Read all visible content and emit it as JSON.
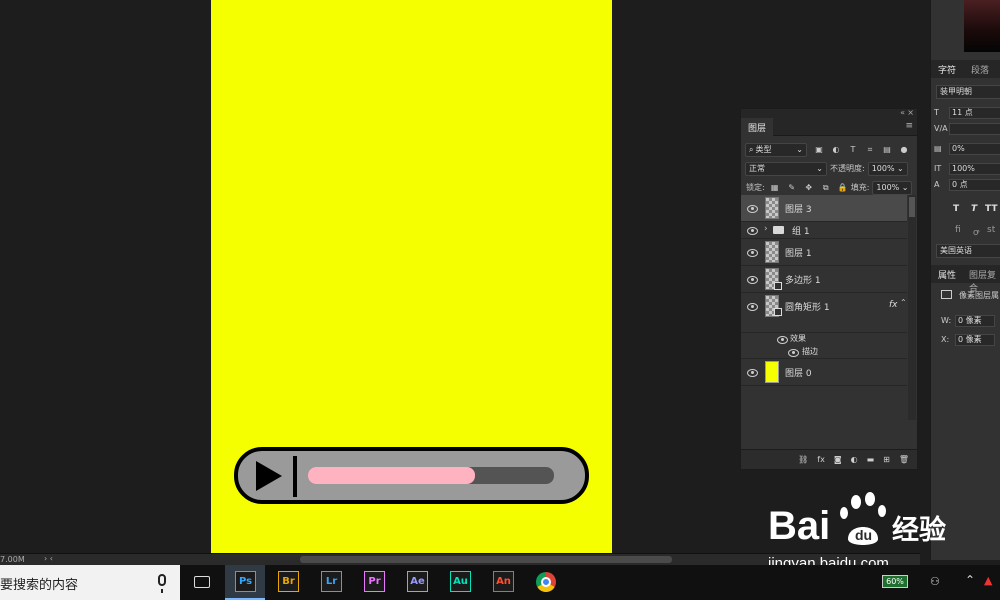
{
  "app": {
    "name": "Photoshop"
  },
  "status_bar": {
    "doc_size": "7.00M",
    "arrows": "› ‹"
  },
  "player": {
    "progress": 0.68,
    "progress_color": "#ffb3c1",
    "canvas_color": "#f5ff00"
  },
  "layers_panel": {
    "tab": "图层",
    "filter": {
      "label": "类型"
    },
    "blend_mode": "正常",
    "opacity_label": "不透明度:",
    "opacity": "100%",
    "lock_label": "锁定:",
    "fill_label": "填充:",
    "fill": "100%",
    "layers": [
      {
        "name": "图层 3",
        "kind": "checker",
        "selected": true,
        "visible": true
      },
      {
        "name": "组 1",
        "kind": "group",
        "selected": false,
        "visible": true
      },
      {
        "name": "图层 1",
        "kind": "checker",
        "selected": false,
        "visible": true
      },
      {
        "name": "多边形 1",
        "kind": "shape",
        "selected": false,
        "visible": true
      },
      {
        "name": "圆角矩形 1",
        "kind": "shape",
        "selected": false,
        "visible": true,
        "fx": "fx",
        "effects_label": "效果",
        "effects": [
          "描边"
        ]
      },
      {
        "name": "图层 0",
        "kind": "yellow",
        "selected": false,
        "visible": true
      }
    ]
  },
  "character_panel": {
    "tabs": [
      "字符",
      "段落"
    ],
    "font_family": "装甲明朝",
    "font_size": "11 点",
    "va_value": "",
    "scale_pct": "0%",
    "vertical_scale": "100%",
    "baseline": "0 点",
    "language": "美国英语"
  },
  "properties_panel": {
    "tabs": [
      "属性",
      "图层复合"
    ],
    "pixel_layer_label": "像素图层属",
    "w_label": "W:",
    "w_value": "0 像素",
    "x_label": "X:",
    "x_value": "0 像素"
  },
  "taskbar": {
    "search_placeholder": "要搜索的内容",
    "apps": [
      {
        "label": "Ps",
        "color": "#31a8ff",
        "active": true
      },
      {
        "label": "Br",
        "color": "#e8a600"
      },
      {
        "label": "Lr",
        "color": "#31a8ff"
      },
      {
        "label": "Pr",
        "color": "#ea77ff"
      },
      {
        "label": "Ae",
        "color": "#9999ff"
      },
      {
        "label": "Au",
        "color": "#00e4bb"
      },
      {
        "label": "An",
        "color": "#ff4f2f"
      }
    ],
    "battery": "60%"
  },
  "watermark": {
    "brand": "Baidu经验",
    "url": "jingyan.baidu.com"
  }
}
